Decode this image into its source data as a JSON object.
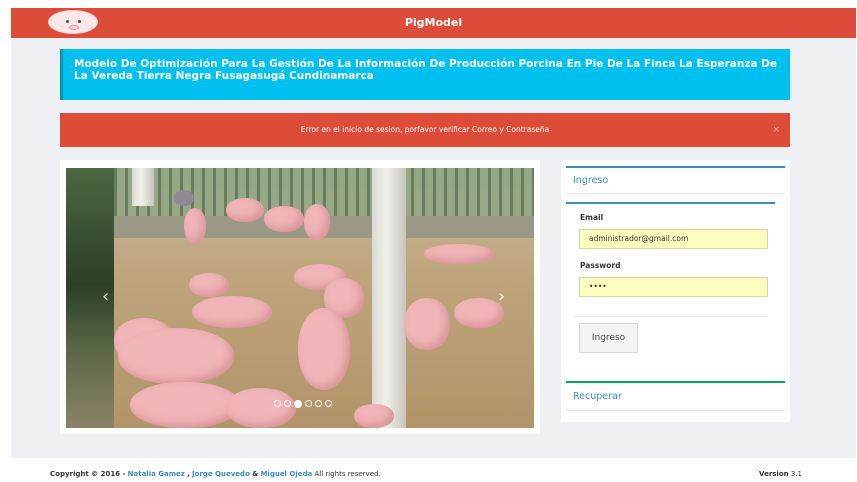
{
  "navbar": {
    "brand": "PigModel"
  },
  "title_box": {
    "text": "Modelo De Optimización Para La Gestión De La Información De Producción Porcina En Pie De La Finca La Esperanza De La Vereda Tierra Negra Fusagasugá Cundinamarca"
  },
  "alert": {
    "message": "Error en el inicio de sesion, porfavor verificar Correo y Contraseña",
    "close": "×"
  },
  "carousel": {
    "prev": "‹",
    "next": "›",
    "slide_count": 6,
    "active_slide": 2
  },
  "login": {
    "header": "Ingreso",
    "email_label": "Email",
    "email_value": "administrador@gmail.com",
    "password_label": "Password",
    "password_value": "••••",
    "submit_label": "Ingreso"
  },
  "recover": {
    "header": "Recuperar"
  },
  "footer": {
    "copyright": "Copyright © 2016 -",
    "author1": "Natalia Gamez",
    "sep1": ",",
    "author2": "Jorge Quevedo",
    "sep2": "&",
    "author3": "Miguel Ojeda",
    "rights": "All rights reserved.",
    "version_label": "Version",
    "version_value": "3.1"
  },
  "colors": {
    "navbar": "#dd4b39",
    "info": "#00c0ef",
    "danger": "#dd4b39",
    "primary": "#3c8dbc",
    "success": "#00a65a",
    "input_autofill": "#fcfec0"
  }
}
